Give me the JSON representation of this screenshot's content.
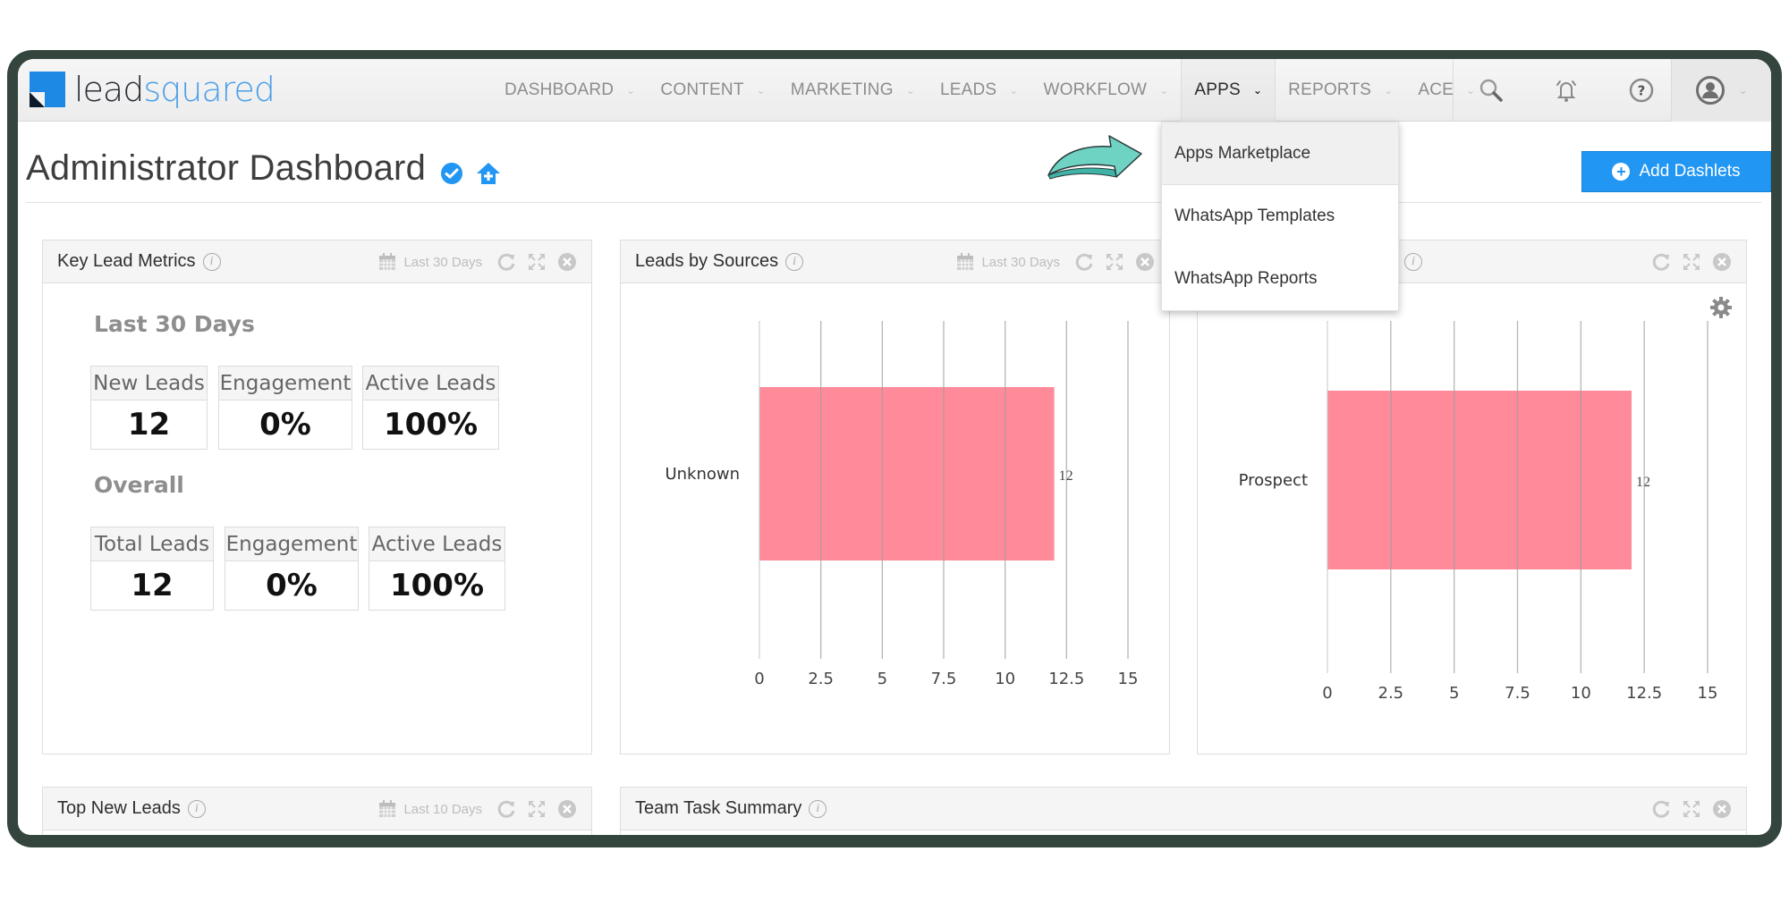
{
  "app": {
    "brand_part1": "lead",
    "brand_part2": "squared"
  },
  "nav": {
    "items": [
      {
        "label": "DASHBOARD",
        "active": false
      },
      {
        "label": "CONTENT",
        "active": false
      },
      {
        "label": "MARKETING",
        "active": false
      },
      {
        "label": "LEADS",
        "active": false
      },
      {
        "label": "WORKFLOW",
        "active": false
      },
      {
        "label": "APPS",
        "active": true
      },
      {
        "label": "REPORTS",
        "active": false
      },
      {
        "label": "ACE",
        "active": false
      }
    ],
    "icons": [
      "search-icon",
      "notification-bell-icon",
      "help-icon",
      "user-avatar-icon"
    ]
  },
  "apps_dropdown": {
    "items": [
      {
        "label": "Apps Marketplace",
        "highlighted": true
      },
      {
        "label": "WhatsApp Templates",
        "highlighted": false
      },
      {
        "label": "WhatsApp Reports",
        "highlighted": false
      }
    ]
  },
  "page": {
    "title": "Administrator Dashboard",
    "add_button_label": "Add Dashlets"
  },
  "colors": {
    "accent": "#2196f3",
    "bar": "#ff8a99",
    "frame": "#33453d",
    "pointer_arrow": "#6fd3c4"
  },
  "dashlets": {
    "key_lead_metrics": {
      "title": "Key Lead Metrics",
      "date_range": "Last 30 Days",
      "sections": [
        {
          "label": "Last 30 Days",
          "metrics": [
            {
              "label": "New Leads",
              "value": "12"
            },
            {
              "label": "Engagement",
              "value": "0%"
            },
            {
              "label": "Active Leads",
              "value": "100%"
            }
          ]
        },
        {
          "label": "Overall",
          "metrics": [
            {
              "label": "Total Leads",
              "value": "12"
            },
            {
              "label": "Engagement",
              "value": "0%"
            },
            {
              "label": "Active Leads",
              "value": "100%"
            }
          ]
        }
      ]
    },
    "leads_by_sources": {
      "title": "Leads by Sources",
      "date_range": "Last 30 Days"
    },
    "leads_by_stage": {
      "title": ""
    },
    "top_new_leads": {
      "title": "Top New Leads",
      "date_range": "Last 10 Days"
    },
    "team_task_summary": {
      "title": "Team Task Summary"
    }
  },
  "chart_data": [
    {
      "type": "bar",
      "orientation": "horizontal",
      "title": "Leads by Sources",
      "categories": [
        "Unknown"
      ],
      "values": [
        12
      ],
      "data_labels": [
        "12"
      ],
      "xlim": [
        0,
        15
      ],
      "x_ticks": [
        "0",
        "2.5",
        "5",
        "7.5",
        "10",
        "12.5",
        "15"
      ],
      "xlabel": "",
      "ylabel": "",
      "grid": true
    },
    {
      "type": "bar",
      "orientation": "horizontal",
      "title": "",
      "categories": [
        "Prospect"
      ],
      "values": [
        12
      ],
      "data_labels": [
        "12"
      ],
      "xlim": [
        0,
        15
      ],
      "x_ticks": [
        "0",
        "2.5",
        "5",
        "7.5",
        "10",
        "12.5",
        "15"
      ],
      "xlabel": "",
      "ylabel": "",
      "grid": true
    }
  ]
}
